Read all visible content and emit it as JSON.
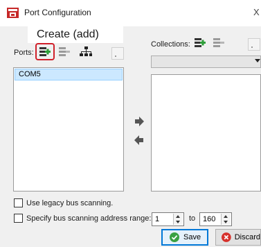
{
  "window": {
    "title": "Port Configuration",
    "close_glyph": "X"
  },
  "tooltip": {
    "text": "Create (add)"
  },
  "ports": {
    "label": "Ports:",
    "items": [
      "COM5"
    ],
    "toolbar": {
      "add_icon": "add-port-icon",
      "edit_icon": "edit-port-icon",
      "network_icon": "network-icon"
    }
  },
  "collections": {
    "label": "Collections:",
    "selected": "",
    "toolbar": {
      "add_icon": "add-collection-icon",
      "edit_icon": "edit-collection-icon"
    }
  },
  "options": {
    "legacy_scan_label": "Use legacy bus scanning.",
    "legacy_scan_checked": false,
    "range_label": "Specify bus scanning address range:",
    "range_checked": false,
    "range_from": "1",
    "range_to_label": "to",
    "range_to": "160"
  },
  "buttons": {
    "save": "Save",
    "discard": "Discard"
  },
  "colors": {
    "highlight": "#d0202a",
    "selection": "#cce8ff",
    "focus_border": "#0078d7"
  }
}
